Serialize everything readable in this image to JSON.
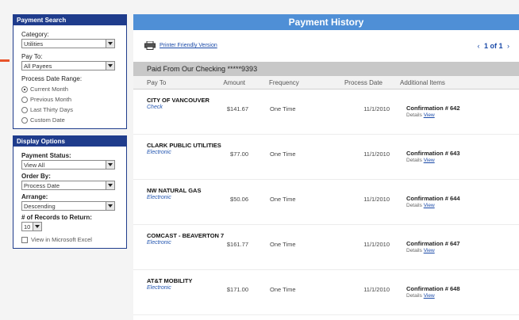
{
  "payment_search": {
    "title": "Payment Search",
    "category_label": "Category:",
    "category_value": "Utilities",
    "pay_to_label": "Pay To:",
    "pay_to_value": "All Payees",
    "range_label": "Process Date Range:",
    "range_options": [
      {
        "label": "Current Month",
        "selected": true
      },
      {
        "label": "Previous Month",
        "selected": false
      },
      {
        "label": "Last Thirty Days",
        "selected": false
      },
      {
        "label": "Custom Date",
        "selected": false
      }
    ]
  },
  "display_options": {
    "title": "Display Options",
    "status_label": "Payment Status:",
    "status_value": "View All",
    "order_label": "Order By:",
    "order_value": "Process Date",
    "arrange_label": "Arrange:",
    "arrange_value": "Descending",
    "records_label": "# of Records to Return:",
    "records_value": "10",
    "excel_label": "View in Microsoft Excel"
  },
  "main": {
    "title": "Payment History",
    "print_link": "Printer Friendly Version",
    "pager": {
      "prev": "‹",
      "text": "1 of 1",
      "next": "›"
    },
    "account": "Paid From Our Checking *****9393",
    "columns": {
      "pay_to": "Pay To",
      "amount": "Amount",
      "frequency": "Frequency",
      "process_date": "Process Date",
      "additional": "Additional Items"
    },
    "rows": [
      {
        "payee": "CITY OF VANCOUVER",
        "method": "Check",
        "amount": "$141.67",
        "frequency": "One Time",
        "date": "11/1/2010",
        "confirmation": "Confirmation # 642",
        "details_label": "Details",
        "view": "View"
      },
      {
        "payee": "CLARK PUBLIC UTILITIES",
        "method": "Electronic",
        "amount": "$77.00",
        "frequency": "One Time",
        "date": "11/1/2010",
        "confirmation": "Confirmation # 643",
        "details_label": "Details",
        "view": "View"
      },
      {
        "payee": "NW NATURAL GAS",
        "method": "Electronic",
        "amount": "$50.06",
        "frequency": "One Time",
        "date": "11/1/2010",
        "confirmation": "Confirmation # 644",
        "details_label": "Details",
        "view": "View"
      },
      {
        "payee": "COMCAST - BEAVERTON 7",
        "method": "Electronic",
        "amount": "$161.77",
        "frequency": "One Time",
        "date": "11/1/2010",
        "confirmation": "Confirmation # 647",
        "details_label": "Details",
        "view": "View"
      },
      {
        "payee": "AT&T MOBILITY",
        "method": "Electronic",
        "amount": "$171.00",
        "frequency": "One Time",
        "date": "11/1/2010",
        "confirmation": "Confirmation # 648",
        "details_label": "Details",
        "view": "View"
      }
    ]
  },
  "colors": {
    "panel_header": "#1f3c8c",
    "title_bar": "#4f8fd6",
    "link": "#1a4aa8",
    "accent": "#e8542a"
  }
}
